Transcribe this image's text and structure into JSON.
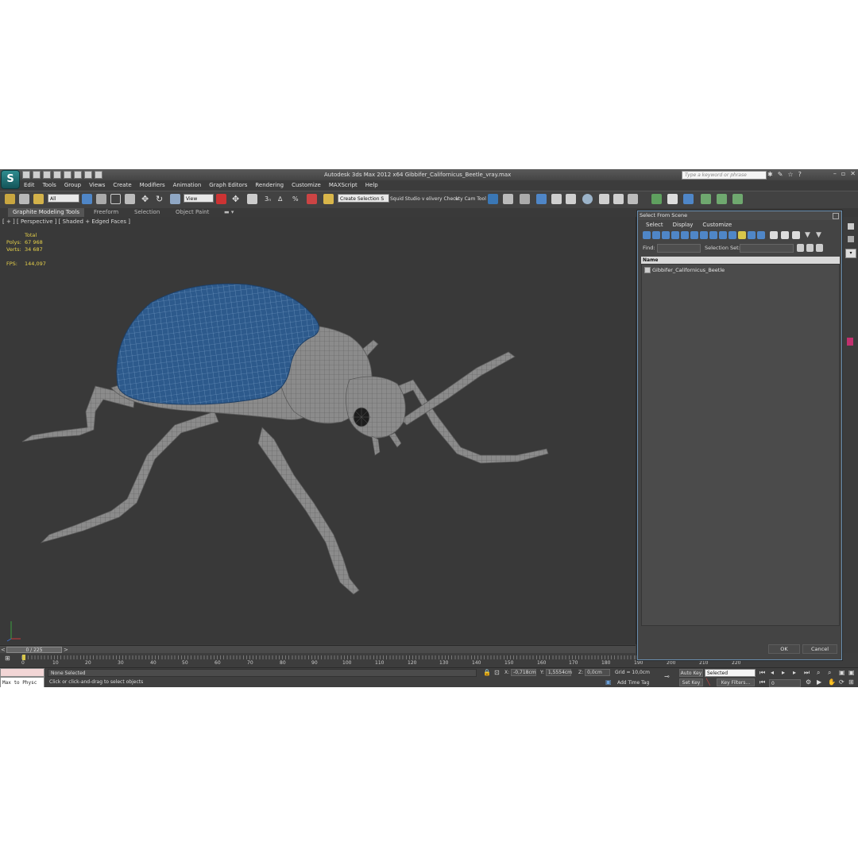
{
  "app": {
    "title": "Autodesk 3ds Max  2012 x64     Gibbifer_Californicus_Beetle_vray.max",
    "logo_letter": "S",
    "search_placeholder": "Type a keyword or phrase"
  },
  "menu": [
    "Edit",
    "Tools",
    "Group",
    "Views",
    "Create",
    "Modifiers",
    "Animation",
    "Graph Editors",
    "Rendering",
    "Customize",
    "MAXScript",
    "Help"
  ],
  "toolbar": {
    "filter": "All",
    "ref_coord": "View",
    "selection_set": "Create Selection S",
    "text1": "Squid Studio v elivery Check",
    "text2": "uty Cam Tool v"
  },
  "ribbon_tabs": [
    "Graphite Modeling Tools",
    "Freeform",
    "Selection",
    "Object Paint"
  ],
  "viewport": {
    "label": "[ + ] [ Perspective ] [ Shaded + Edged Faces ]",
    "stats": {
      "header": "Total",
      "polys_label": "Polys:",
      "polys": "67 968",
      "verts_label": "Verts:",
      "verts": "34 687",
      "fps_label": "FPS:",
      "fps": "144,097"
    }
  },
  "timeslider": {
    "frame": "0 / 225",
    "left_arrow": "<",
    "right_arrow": ">"
  },
  "track_ticks": [
    "0",
    "10",
    "20",
    "30",
    "40",
    "50",
    "60",
    "70",
    "80",
    "90",
    "100",
    "110",
    "120",
    "130",
    "140",
    "150",
    "160",
    "170",
    "180",
    "190",
    "200",
    "210",
    "220"
  ],
  "status": {
    "maxscript": "Max to Physc",
    "selection": "None Selected",
    "prompt": "Click or click-and-drag to select objects",
    "x_label": "X:",
    "x": "-0,718cm",
    "y_label": "Y:",
    "y": "1,5554cm",
    "z_label": "Z:",
    "z": "0,0cm",
    "grid": "Grid = 10,0cm",
    "add_time_tag": "Add Time Tag",
    "auto_key": "Auto Key",
    "auto_key_value": "Selected",
    "set_key": "Set Key",
    "key_filters": "Key Filters...",
    "frame_field": "0"
  },
  "dialog": {
    "title": "Select From Scene",
    "menu": [
      "Select",
      "Display",
      "Customize"
    ],
    "find_label": "Find:",
    "selection_set_label": "Selection Set:",
    "column_name": "Name",
    "items": [
      "Gibbifer_Californicus_Beetle"
    ],
    "ok": "OK",
    "cancel": "Cancel"
  },
  "colors": {
    "viewport_bg": "#393939",
    "shell_blue": "#2d5a8c",
    "mesh_grey": "#8a8a8a",
    "stats_yellow": "#e7d14a",
    "dialog_border": "#6a8fb0"
  }
}
